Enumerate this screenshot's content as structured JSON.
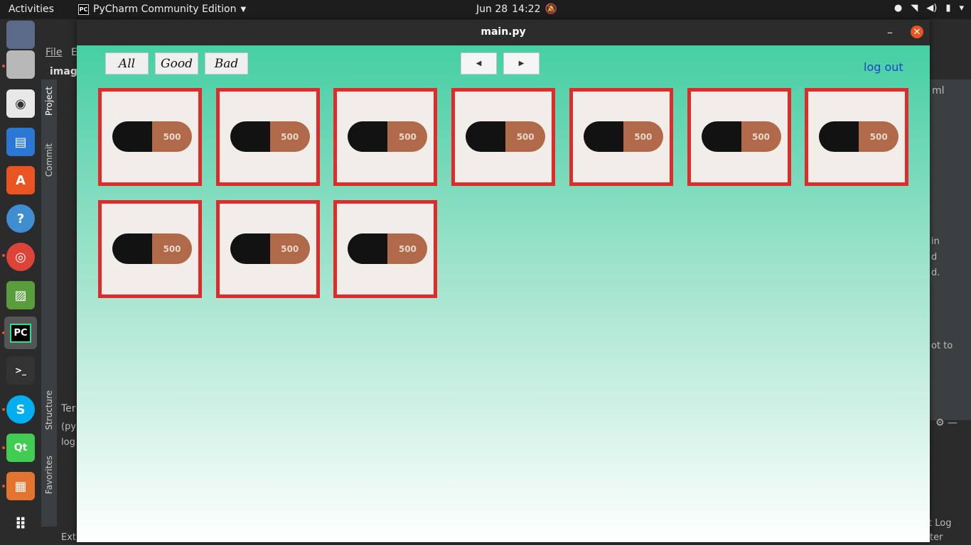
{
  "topbar": {
    "activities": "Activities",
    "app_name": "PyCharm Community Edition",
    "app_icon": "PC",
    "date": "Jun 28",
    "time": "14:22"
  },
  "ide": {
    "menu_file": "File",
    "menu_edit": "E",
    "project_name": "image",
    "tab_project": "Project",
    "tab_commit": "Commit",
    "tab_structure": "Structure",
    "tab_favorites": "Favorites",
    "terminal_label": "Ter",
    "terminal_line1": "(py",
    "terminal_line2": "log",
    "right_text1": "ml",
    "right_text2": "in",
    "right_text3": "d",
    "right_text4": "d.",
    "right_text5": "ot to",
    "bottom_log": "t Log",
    "bottom_ext": "Ext",
    "bottom_ter": "ter"
  },
  "window": {
    "title": "main.py",
    "close_glyph": "✕",
    "minimize_glyph": "–"
  },
  "toolbar": {
    "all_label": "All",
    "good_label": "Good",
    "bad_label": "Bad",
    "prev_glyph": "◀",
    "next_glyph": "▶",
    "logout_label": "log out"
  },
  "images": [
    {
      "label": "500",
      "status": "bad"
    },
    {
      "label": "500",
      "status": "bad"
    },
    {
      "label": "500",
      "status": "bad"
    },
    {
      "label": "500",
      "status": "bad"
    },
    {
      "label": "500",
      "status": "bad"
    },
    {
      "label": "500",
      "status": "bad"
    },
    {
      "label": "500",
      "status": "bad"
    },
    {
      "label": "500",
      "status": "bad"
    },
    {
      "label": "500",
      "status": "bad"
    },
    {
      "label": "500",
      "status": "bad"
    }
  ],
  "colors": {
    "tile_border": "#e12a2a",
    "gradient_top": "#45cfa3",
    "logout_link": "#1b45c8",
    "close_button": "#e95420"
  }
}
